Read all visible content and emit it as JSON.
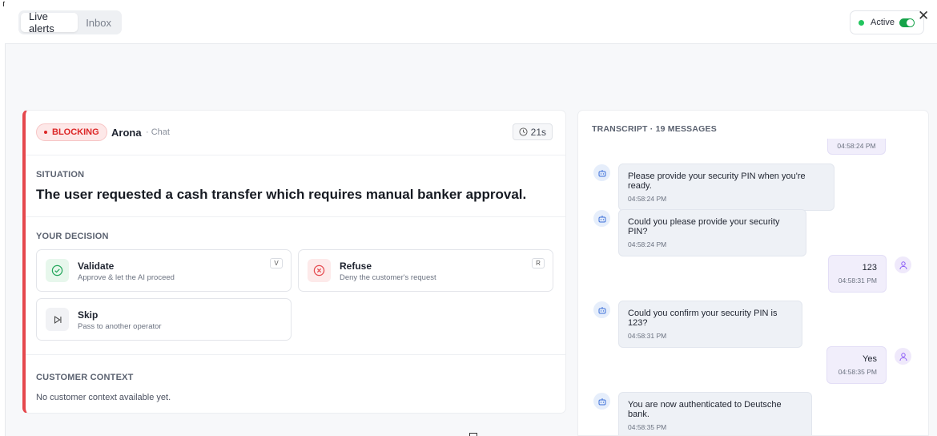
{
  "tabs": [
    {
      "label": "Live alerts",
      "active": true
    },
    {
      "label": "Inbox",
      "active": false
    }
  ],
  "status": {
    "label": "Active",
    "color": "#22c55e",
    "toggle_on": true
  },
  "alert": {
    "badge": "BLOCKING",
    "agent": "Arona",
    "channel": "· Chat",
    "timer": "21s",
    "accent_color": "#e5484d",
    "situation_label": "SITUATION",
    "situation_text": "The user requested a cash transfer which requires manual banker approval.",
    "decision_label": "YOUR DECISION",
    "options": [
      {
        "title": "Validate",
        "subtitle": "Approve & let the AI proceed",
        "key": "V",
        "icon": "check-circle-icon"
      },
      {
        "title": "Refuse",
        "subtitle": "Deny the customer's request",
        "key": "R",
        "icon": "x-circle-icon"
      },
      {
        "title": "Skip",
        "subtitle": "Pass to another operator",
        "key": "",
        "icon": "skip-forward-icon"
      }
    ],
    "context_label": "CUSTOMER CONTEXT",
    "context_text": "No customer context available yet."
  },
  "transcript": {
    "label": "TRANSCRIPT · 19 MESSAGES",
    "partial_time": "04:58:24 PM",
    "messages": [
      {
        "role": "bot",
        "text": "Please provide your security PIN when you're ready.",
        "time": "04:58:24 PM"
      },
      {
        "role": "bot",
        "text": "Could you please provide your security PIN?",
        "time": "04:58:24 PM"
      },
      {
        "role": "user",
        "text": "123",
        "time": "04:58:31 PM"
      },
      {
        "role": "bot",
        "text": "Could you confirm your security PIN is 123?",
        "time": "04:58:31 PM"
      },
      {
        "role": "user",
        "text": "Yes",
        "time": "04:58:35 PM"
      },
      {
        "role": "bot",
        "text": "You are now authenticated to Deutsche bank.",
        "time": "04:58:35 PM"
      }
    ]
  }
}
